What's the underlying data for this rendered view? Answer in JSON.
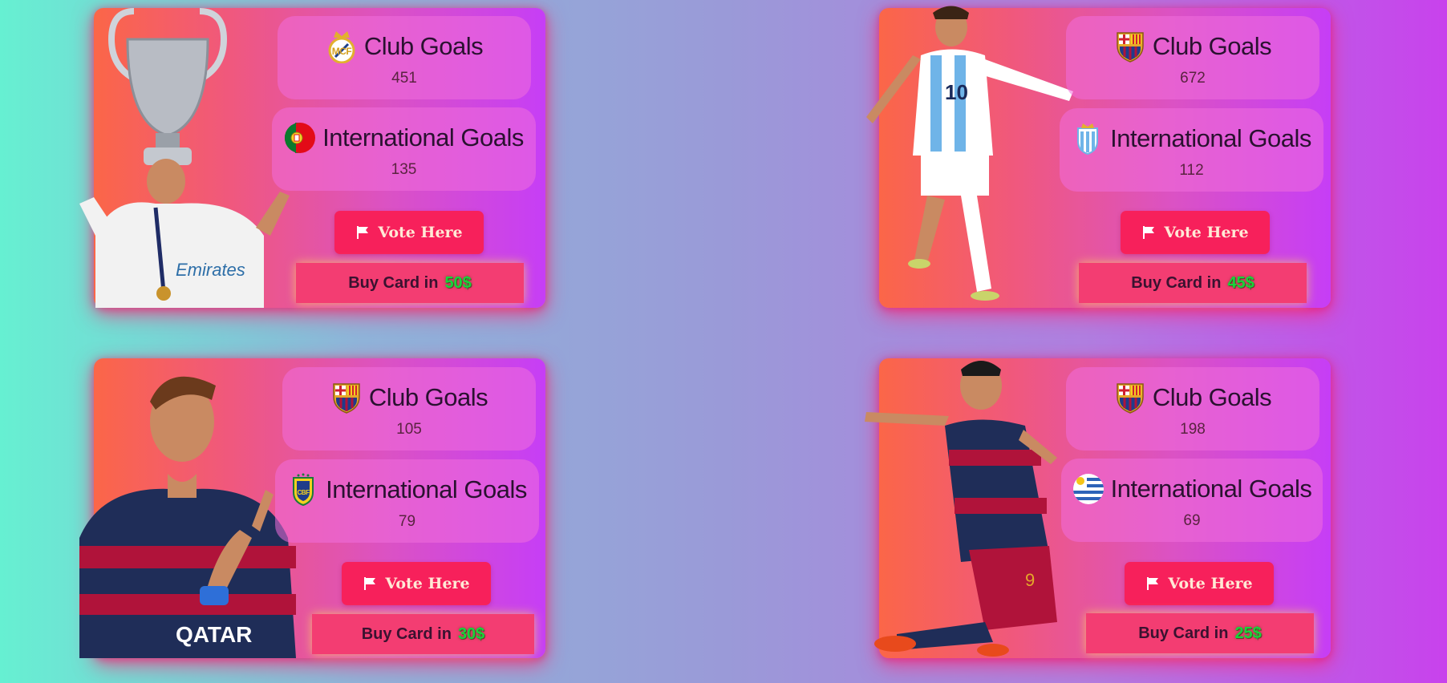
{
  "cards": [
    {
      "player_icon": "player-photo-trophy",
      "club_crest_icon": "real-madrid-crest-icon",
      "country_flag_icon": "portugal-flag-icon",
      "club_goals_label": "Club Goals",
      "club_goals": "451",
      "intl_goals_label": "International Goals",
      "intl_goals": "135",
      "vote_label": "Vote Here",
      "buy_label": "Buy Card in",
      "price": "50$"
    },
    {
      "player_icon": "player-photo-white-blue-kit",
      "club_crest_icon": "barcelona-crest-icon",
      "country_flag_icon": "argentina-crest-icon",
      "club_goals_label": "Club Goals",
      "club_goals": "672",
      "intl_goals_label": "International Goals",
      "intl_goals": "112",
      "vote_label": "Vote Here",
      "buy_label": "Buy Card in",
      "price": "45$"
    },
    {
      "player_icon": "player-photo-blaugrana-kit",
      "club_crest_icon": "barcelona-crest-icon",
      "country_flag_icon": "brazil-crest-icon",
      "club_goals_label": "Club Goals",
      "club_goals": "105",
      "intl_goals_label": "International Goals",
      "intl_goals": "79",
      "vote_label": "Vote Here",
      "buy_label": "Buy Card in",
      "price": "30$"
    },
    {
      "player_icon": "player-photo-celebrating",
      "club_crest_icon": "barcelona-crest-icon",
      "country_flag_icon": "uruguay-flag-icon",
      "club_goals_label": "Club Goals",
      "club_goals": "198",
      "intl_goals_label": "International Goals",
      "intl_goals": "69",
      "vote_label": "Vote Here",
      "buy_label": "Buy Card in",
      "price": "25$"
    }
  ],
  "colors": {
    "card_gradient_start": "#fb6648",
    "card_gradient_end": "#c63ef6",
    "vote_button": "#f7205b",
    "buy_button": "#f33d72",
    "price": "#17d43a"
  },
  "icons": {
    "vote_icon": "flag-icon"
  }
}
